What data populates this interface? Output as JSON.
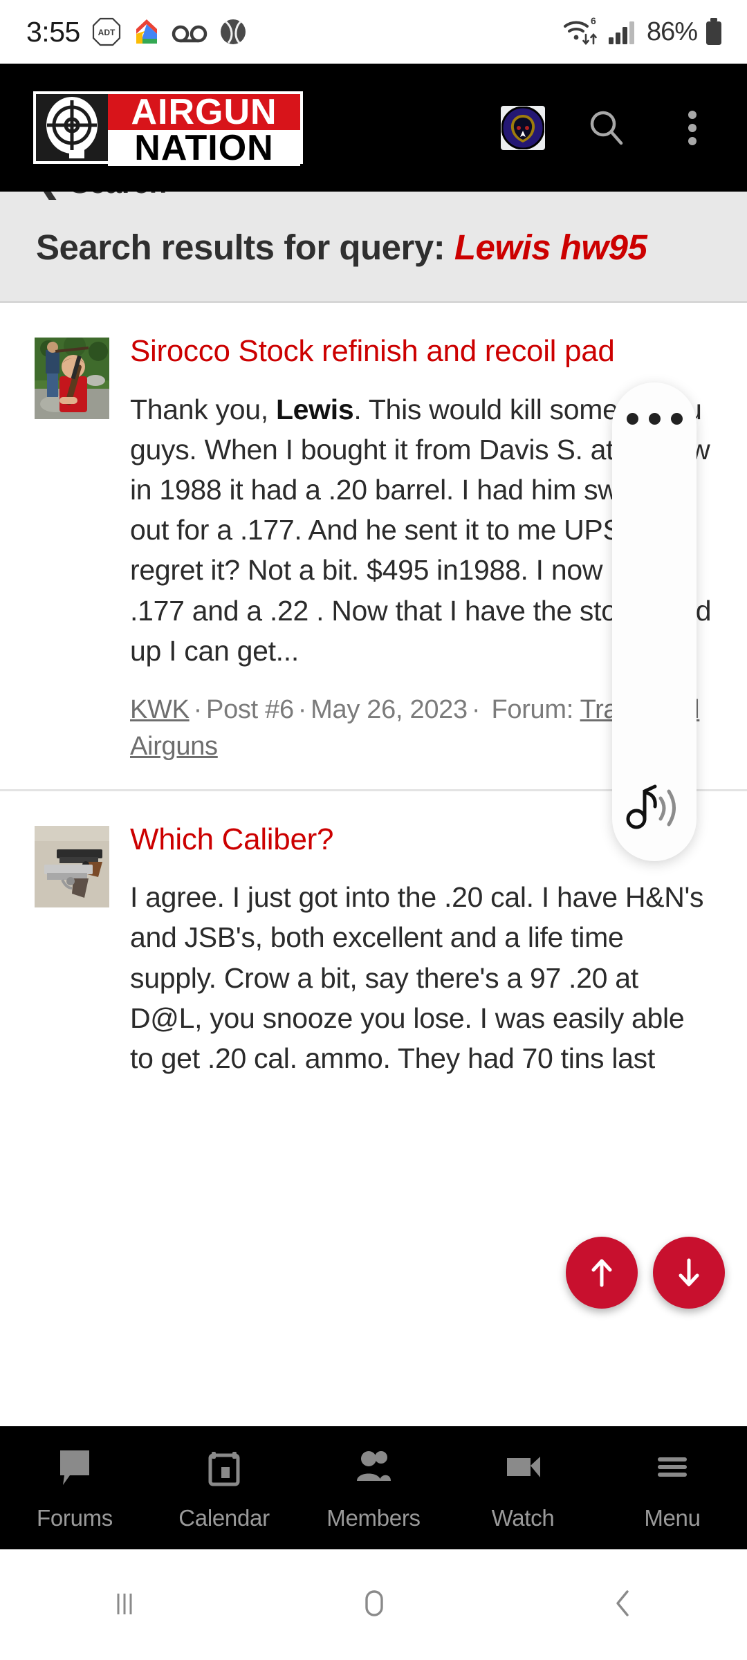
{
  "status_bar": {
    "clock": "3:55",
    "battery_percent": "86%",
    "icons": [
      "adt-icon",
      "google-home-icon",
      "voicemail-icon",
      "baseball-icon",
      "wifi-6-icon",
      "cellular-signal-icon",
      "battery-icon"
    ]
  },
  "header": {
    "logo_top": "AIRGUN",
    "logo_bottom": "NATION",
    "logo_mark": "crosshair-scope-icon",
    "avatar": "ravens-avatar-icon",
    "search": "search-icon",
    "overflow": "three-dots-vertical-icon"
  },
  "page": {
    "breadcrumb": "Search",
    "breadcrumb_icon": "chevron-left-icon",
    "title_prefix": "Search results for query:",
    "title_query": "Lewis hw95"
  },
  "results": [
    {
      "thumb": "boy-with-airrifle-thumbnail",
      "title": "Sirocco Stock refinish and recoil pad",
      "snippet_pre": "Thank you, ",
      "snippet_bold": "Lewis",
      "snippet_post": ". This would kill some of you guys. When I bought it from Davis S. at a show in 1988 it had a .20 barrel. I had him swap it out for a .177. And he sent it to me UPS. Did I regret it? Not a bit. $495 in1988. I now have a .177 and a .22 . Now that I have the stock fixed up I can get...",
      "author": "KWK",
      "post": "Post #6",
      "date": "May 26, 2023",
      "forum_label": "Forum:",
      "forum_name": "Traditional Airguns"
    },
    {
      "thumb": "two-pistols-thumbnail",
      "title": "Which Caliber?",
      "snippet_pre": "",
      "snippet_bold": "",
      "snippet_post": "I agree. I just got into the .20 cal. I have H&N's and JSB's, both excellent and a life time supply. Crow a bit, say there's a 97 .20 at D@L, you snooze you lose. I was easily able to get .20 cal. ammo. They had 70 tins last"
    }
  ],
  "overlay": {
    "pill_dots": "three-dots-horizontal-icon",
    "pill_music": "music-sound-icon",
    "scroll_up": "arrow-up-icon",
    "scroll_down": "arrow-down-icon"
  },
  "tabbar": [
    {
      "label": "Forums",
      "icon": "speech-bubble-icon"
    },
    {
      "label": "Calendar",
      "icon": "calendar-icon"
    },
    {
      "label": "Members",
      "icon": "people-icon"
    },
    {
      "label": "Watch",
      "icon": "video-camera-icon"
    },
    {
      "label": "Menu",
      "icon": "hamburger-menu-icon"
    }
  ],
  "android_nav": [
    {
      "name": "recents-button",
      "icon": "three-vertical-bars-icon"
    },
    {
      "name": "home-button",
      "icon": "rounded-square-icon"
    },
    {
      "name": "back-button",
      "icon": "chevron-left-icon"
    }
  ],
  "colors": {
    "brand_red": "#d8141a",
    "link_red": "#cc0000",
    "fab_red": "#c8102e",
    "header_black": "#000000",
    "page_head_gray": "#e8e8e8"
  }
}
